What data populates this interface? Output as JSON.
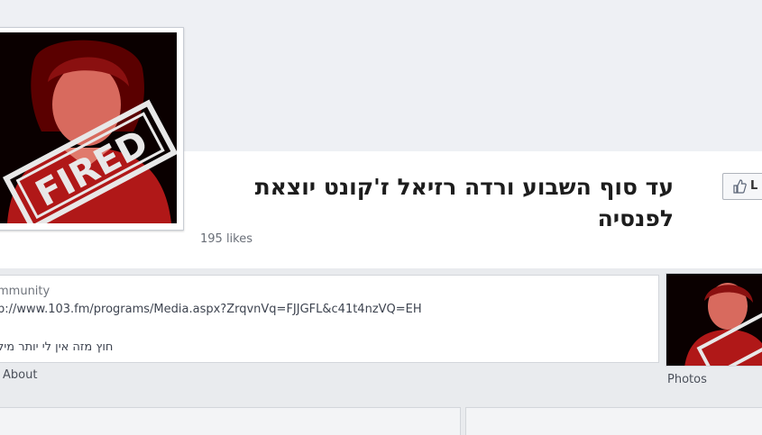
{
  "page": {
    "title": "עד סוף השבוע ורדה רזיאל ז'קונט יוצאת לפנסיה",
    "likes": "195 likes"
  },
  "like_button": {
    "label": "L",
    "icon": "thumbs-up-icon"
  },
  "profile_picture": {
    "stamp_text": "FIRED",
    "icon": "profile-photo"
  },
  "info": {
    "category": "mmunity",
    "link": "p://www.103.fm/programs/Media.aspx?ZrqvnVq=FJJGFL&c41t4nzVQ=EH",
    "description": "חוץ מזה אין לי יותר מיל"
  },
  "about_link": "About",
  "photos_label": "Photos",
  "colors": {
    "background": "#e9ebee",
    "stamp": "#e8e8e8",
    "photo_red": "#c02020"
  }
}
